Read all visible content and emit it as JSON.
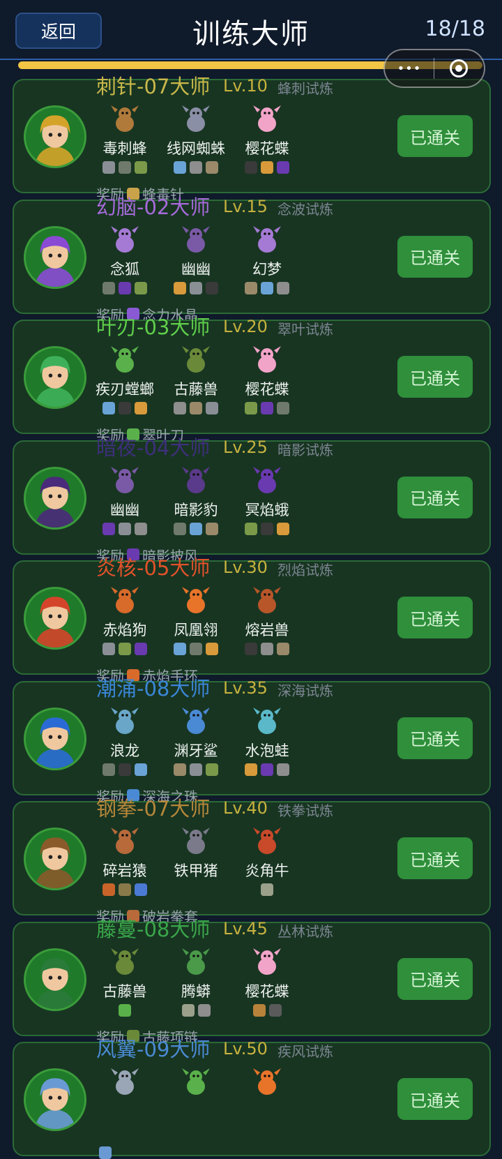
{
  "header": {
    "back_label": "返回",
    "title": "训练大师",
    "progress_text": "18/18",
    "progress_fraction": 1.0,
    "capsule_dots": "•••"
  },
  "masters": [
    {
      "title": "刺针-07大师",
      "title_color": "#c9b84a",
      "level": "Lv.10",
      "trial": "蜂刺试炼",
      "avatar_color": "#d4a329",
      "pets": [
        {
          "name": "毒刺蜂",
          "color": "#b07a3a",
          "gears": [
            "#8a8f96",
            "#6f7a6d",
            "#7a9a4a"
          ]
        },
        {
          "name": "线网蜘蛛",
          "color": "#8a8fa6",
          "gears": [
            "#6aa3d6",
            "#8e8e8e",
            "#9a8a6a"
          ]
        },
        {
          "name": "樱花蝶",
          "color": "#f2a4c8",
          "gears": [
            "#3a3a3a",
            "#d89a3a",
            "#6a3ab0"
          ]
        }
      ],
      "status": "已通关",
      "reward_label": "奖励",
      "reward": "蜂毒针",
      "reward_color": "#c9a34a"
    },
    {
      "title": "幻脑-02大师",
      "title_color": "#a56ad9",
      "level": "Lv.15",
      "trial": "念波试炼",
      "avatar_color": "#8a4ad4",
      "pets": [
        {
          "name": "念狐",
          "color": "#a57ad4",
          "gears": [
            "#6f7a6d",
            "#6a3ab0",
            "#7a9a4a"
          ]
        },
        {
          "name": "幽幽",
          "color": "#7a5aa6",
          "gears": [
            "#d89a3a",
            "#8a8f96",
            "#3a3a3a"
          ]
        },
        {
          "name": "幻梦",
          "color": "#a57ad4",
          "gears": [
            "#9a8a6a",
            "#6aa3d6",
            "#8e8e8e"
          ]
        }
      ],
      "status": "已通关",
      "reward_label": "奖励",
      "reward": "念力水晶",
      "reward_color": "#8a5ad4"
    },
    {
      "title": "叶刃-03大师",
      "title_color": "#5fcf4a",
      "level": "Lv.20",
      "trial": "翠叶试炼",
      "avatar_color": "#3fb05a",
      "pets": [
        {
          "name": "疾刃螳螂",
          "color": "#5ab04a",
          "gears": [
            "#6aa3d6",
            "#3a3a3a",
            "#d89a3a"
          ]
        },
        {
          "name": "古藤兽",
          "color": "#6a8a3a",
          "gears": [
            "#8e8e8e",
            "#9a8a6a",
            "#8a8f96"
          ]
        },
        {
          "name": "樱花蝶",
          "color": "#f2a4c8",
          "gears": [
            "#7a9a4a",
            "#6a3ab0",
            "#6f7a6d"
          ]
        }
      ],
      "status": "已通关",
      "reward_label": "奖励",
      "reward": "翠叶刀",
      "reward_color": "#5ab04a"
    },
    {
      "title": "暗夜-04大师",
      "title_color": "#3d2f7a",
      "level": "Lv.25",
      "trial": "暗影试炼",
      "avatar_color": "#4a2a7a",
      "pets": [
        {
          "name": "幽幽",
          "color": "#7a5aa6",
          "gears": [
            "#6a3ab0",
            "#8a8f96",
            "#8e8e8e"
          ]
        },
        {
          "name": "暗影豹",
          "color": "#5a3a8a",
          "gears": [
            "#6f7a6d",
            "#6aa3d6",
            "#9a8a6a"
          ]
        },
        {
          "name": "冥焰蛾",
          "color": "#6a3ab0",
          "gears": [
            "#7a9a4a",
            "#3a3a3a",
            "#d89a3a"
          ]
        }
      ],
      "status": "已通关",
      "reward_label": "奖励",
      "reward": "暗影披风",
      "reward_color": "#6a3ab0"
    },
    {
      "title": "炎核-05大师",
      "title_color": "#e0522a",
      "level": "Lv.30",
      "trial": "烈焰试炼",
      "avatar_color": "#d4442a",
      "pets": [
        {
          "name": "赤焰狗",
          "color": "#d86a2a",
          "gears": [
            "#8a8f96",
            "#7a9a4a",
            "#6a3ab0"
          ]
        },
        {
          "name": "凤凰翎",
          "color": "#e8742a",
          "gears": [
            "#6aa3d6",
            "#6f7a6d",
            "#d89a3a"
          ]
        },
        {
          "name": "熔岩兽",
          "color": "#b8562a",
          "gears": [
            "#3a3a3a",
            "#8e8e8e",
            "#9a8a6a"
          ]
        }
      ],
      "status": "已通关",
      "reward_label": "奖励",
      "reward": "赤焰手环",
      "reward_color": "#d86a2a"
    },
    {
      "title": "潮涌-08大师",
      "title_color": "#3a86d6",
      "level": "Lv.35",
      "trial": "深海试炼",
      "avatar_color": "#2a6ad4",
      "pets": [
        {
          "name": "浪龙",
          "color": "#6aa6c8",
          "gears": [
            "#6f7a6d",
            "#3a3a3a",
            "#6aa3d6"
          ]
        },
        {
          "name": "渊牙鲨",
          "color": "#4a8ad4",
          "gears": [
            "#9a8a6a",
            "#8a8f96",
            "#7a9a4a"
          ]
        },
        {
          "name": "水泡蛙",
          "color": "#5ab8c8",
          "gears": [
            "#d89a3a",
            "#6a3ab0",
            "#8e8e8e"
          ]
        }
      ],
      "status": "已通关",
      "reward_label": "奖励",
      "reward": "深海之珠",
      "reward_color": "#4a8ad4"
    },
    {
      "title": "钢拳-07大师",
      "title_color": "#b5873a",
      "level": "Lv.40",
      "trial": "铁拳试炼",
      "avatar_color": "#8a5a2a",
      "pets": [
        {
          "name": "碎岩猿",
          "color": "#b86a3a",
          "gears": [
            "#c8642a",
            "#8a7a4a",
            "#4a7ad4"
          ]
        },
        {
          "name": "铁甲猪",
          "color": "#7a7a8a",
          "gears": []
        },
        {
          "name": "炎角牛",
          "color": "#c84a2a",
          "gears": [
            "#9aa08a"
          ]
        }
      ],
      "status": "已通关",
      "reward_label": "奖励",
      "reward": "破岩拳套",
      "reward_color": "#b86a3a"
    },
    {
      "title": "藤蔓-08大师",
      "title_color": "#3aa64a",
      "level": "Lv.45",
      "trial": "丛林试炼",
      "avatar_color": "#2a7a3a",
      "pets": [
        {
          "name": "古藤兽",
          "color": "#6a8a3a",
          "gears": [
            "#5ab04a"
          ]
        },
        {
          "name": "腾蟒",
          "color": "#4a9a4a",
          "gears": [
            "#9aa08a",
            "#8e8e8e"
          ]
        },
        {
          "name": "樱花蝶",
          "color": "#f2a4c8",
          "gears": [
            "#b8823a",
            "#5a5a5a"
          ]
        }
      ],
      "status": "已通关",
      "reward_label": "奖励",
      "reward": "古藤项链",
      "reward_color": "#6a8a3a"
    },
    {
      "title": "风翼-09大师",
      "title_color": "#4a8ad4",
      "level": "Lv.50",
      "trial": "疾风试炼",
      "avatar_color": "#6a9ad4",
      "pets": [
        {
          "name": "",
          "color": "#9aa6b6",
          "gears": []
        },
        {
          "name": "",
          "color": "#5ab04a",
          "gears": []
        },
        {
          "name": "",
          "color": "#e8742a",
          "gears": []
        }
      ],
      "status": "已通关",
      "reward_label": "",
      "reward": "",
      "reward_color": "#6a9ad4"
    }
  ]
}
